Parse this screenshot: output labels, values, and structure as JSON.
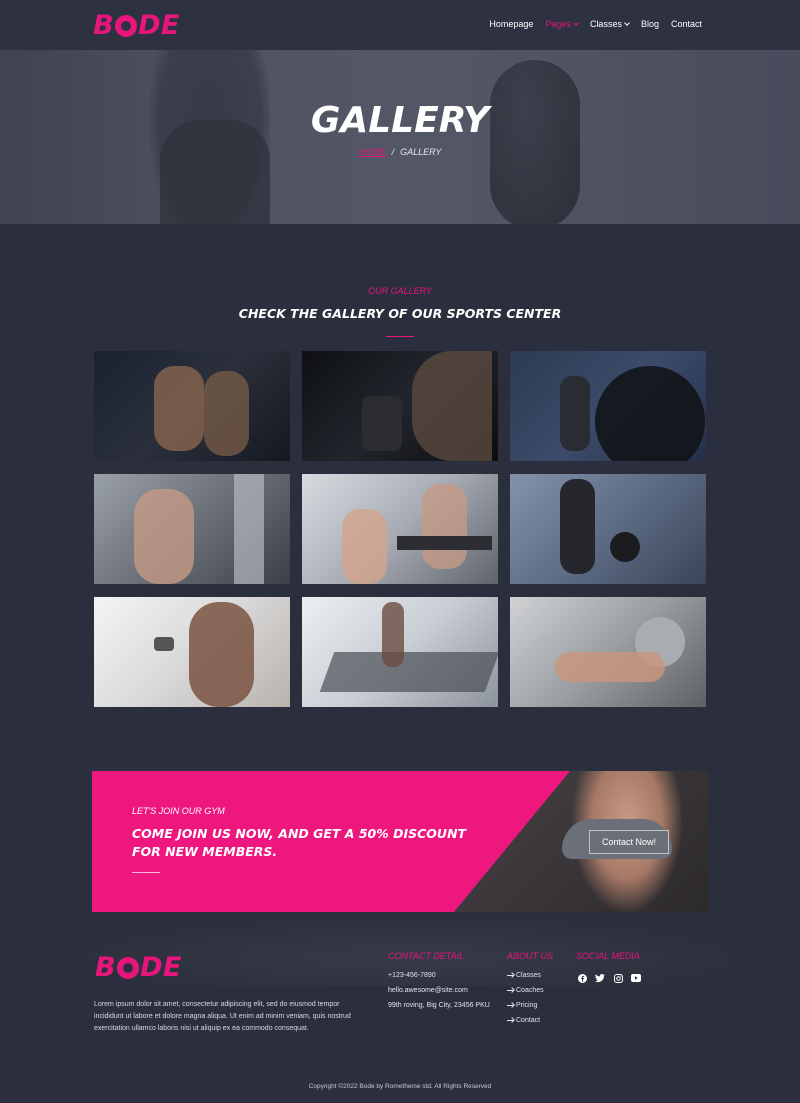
{
  "brand": {
    "logo_text_1": "B",
    "logo_text_2": "DE",
    "accent_color": "#e8157c"
  },
  "nav": {
    "items": [
      {
        "label": "Homepage",
        "active": false,
        "has_dropdown": false
      },
      {
        "label": "Pages",
        "active": true,
        "has_dropdown": true
      },
      {
        "label": "Classes",
        "active": false,
        "has_dropdown": true
      },
      {
        "label": "Blog",
        "active": false,
        "has_dropdown": false
      },
      {
        "label": "Contact",
        "active": false,
        "has_dropdown": false
      }
    ]
  },
  "hero": {
    "title": "GALLERY",
    "breadcrumb": {
      "home": "HOME",
      "separator": "/",
      "current": "GALLERY"
    }
  },
  "gallery": {
    "eyebrow": "OUR GALLERY",
    "title": "CHECK THE GALLERY OF OUR SPORTS CENTER",
    "images": [
      "two-men-lifting-dumbbells",
      "tattooed-arm-holding-dumbbell",
      "woman-flipping-tire",
      "woman-dumbbell-curl",
      "woman-on-leg-machine",
      "woman-with-battle-ropes",
      "woman-lifting-dumbbell",
      "woman-on-treadmill",
      "woman-with-exercise-ball"
    ]
  },
  "promo": {
    "eyebrow": "LET'S JOIN OUR GYM",
    "title": "COME JOIN US NOW, AND GET A 50% DISCOUNT FOR NEW MEMBERS.",
    "button": "Contact Now!"
  },
  "footer": {
    "about": "Lorem ipsum dolor sit amet, consectetur adipiscing elit, sed do eiusmod tempor incididunt ut labore et dolore magna aliqua. Ut enim ad minim veniam, quis nostrud exercitation ullamco laboris nisi ut aliquip ex ea commodo consequat.",
    "contact": {
      "title": "CONTACT DETAIL",
      "phone": "+123-456-7890",
      "email": "hello.awesome@site.com",
      "address": "99th roving, Big City, 23456 PKU"
    },
    "about_us": {
      "title": "ABOUT US",
      "links": [
        "Classes",
        "Coaches",
        "Pricing",
        "Contact"
      ]
    },
    "social": {
      "title": "SOCIAL MEDIA",
      "icons": [
        "facebook-icon",
        "twitter-icon",
        "instagram-icon",
        "youtube-icon"
      ]
    },
    "copyright": "Copyright ©2022 Bode by Rometheme std. All Rights Reserved"
  }
}
